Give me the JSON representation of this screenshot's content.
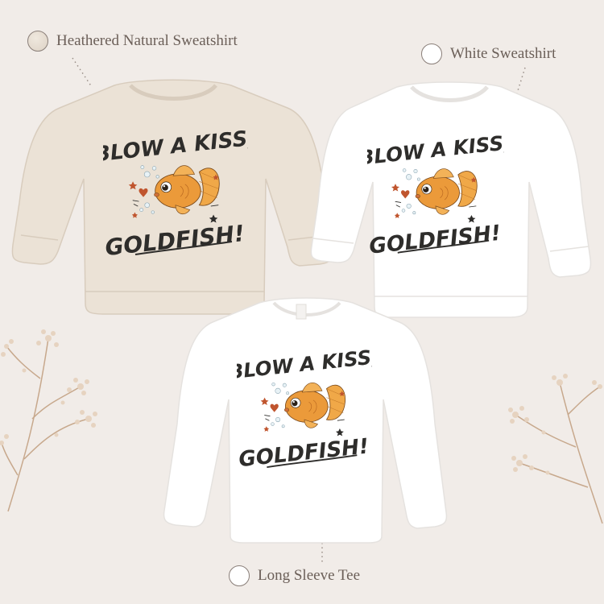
{
  "variants": [
    {
      "label": "Heathered Natural Sweatshirt",
      "color": "#e8dfd3"
    },
    {
      "label": "White Sweatshirt",
      "color": "#ffffff"
    },
    {
      "label": "Long Sleeve Tee",
      "color": "#ffffff"
    }
  ],
  "design": {
    "line1": "BLOW A KISS,",
    "line2": "GOLDFISH!",
    "ink_color": "#2e2d2b",
    "fish_color": "#e89a3a",
    "accent_color": "#c0552e"
  }
}
